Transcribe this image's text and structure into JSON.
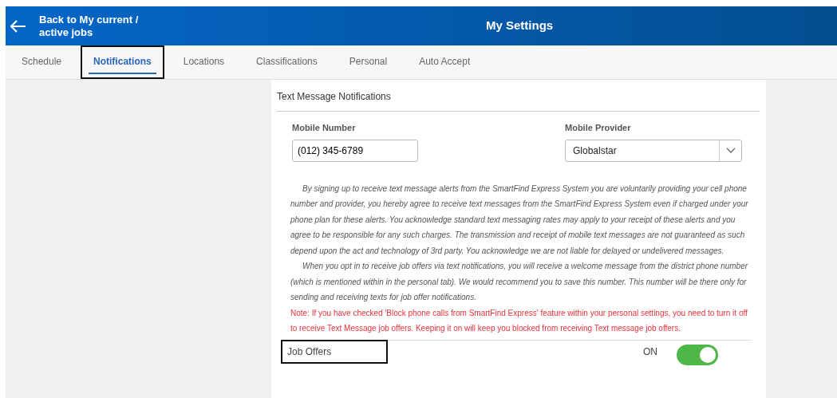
{
  "header": {
    "back_label": "Back to My current / active jobs",
    "title": "My Settings"
  },
  "tabs": [
    {
      "label": "Schedule",
      "selected": false,
      "highlighted": false
    },
    {
      "label": "Notifications",
      "selected": true,
      "highlighted": true
    },
    {
      "label": "Locations",
      "selected": false,
      "highlighted": false
    },
    {
      "label": "Classifications",
      "selected": false,
      "highlighted": false
    },
    {
      "label": "Personal",
      "selected": false,
      "highlighted": false
    },
    {
      "label": "Auto Accept",
      "selected": false,
      "highlighted": false
    }
  ],
  "section": {
    "title": "Text Message Notifications",
    "mobile_number": {
      "label": "Mobile Number",
      "value": "(012) 345-6789"
    },
    "mobile_provider": {
      "label": "Mobile Provider",
      "value": "Globalstar"
    },
    "paragraphs": [
      {
        "kind": "info",
        "text": "By signing up to receive text message alerts from the SmartFind Express System you are voluntarily providing your cell phone number and provider, you hereby agree to receive text messages from the SmartFind Express System even if charged under your phone plan for these alerts. You acknowledge standard text messaging rates may apply to your receipt of these alerts and you agree to be responsible for any such charges. The transmission and receipt of mobile text messages are not guaranteed as such depend upon the act and technology of 3rd party. You acknowledge we are not liable for delayed or undelivered messages."
      },
      {
        "kind": "info",
        "text": "When you opt in to receive job offers via text notifications, you will receive a welcome message from the district phone number (which is mentioned within in the personal tab). We would recommend you to save this number. This number will be there only for sending and receiving texts for job offer notifications."
      },
      {
        "kind": "warning",
        "text": "Note: If you have checked 'Block phone calls from SmartFind Express' feature within your personal settings, you need to turn it off to receive Text Message job offers. Keeping it on will keep you blocked from receiving Text message job offers."
      }
    ],
    "settings": [
      {
        "label": "Job Offers",
        "state_label": "ON",
        "on": true,
        "highlighted": true
      }
    ]
  }
}
